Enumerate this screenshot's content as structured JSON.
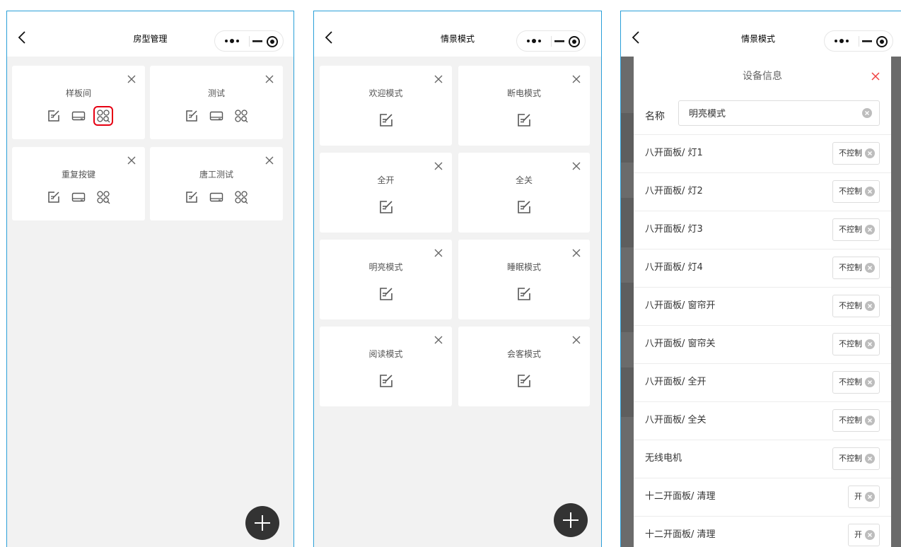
{
  "screen1": {
    "title": "房型管理",
    "cards": [
      {
        "name": "样板间"
      },
      {
        "name": "测试"
      },
      {
        "name": "重复按键"
      },
      {
        "name": "唐工测试"
      }
    ]
  },
  "screen2": {
    "title": "情景模式",
    "cards": [
      {
        "name": "欢迎模式"
      },
      {
        "name": "断电模式"
      },
      {
        "name": "全开"
      },
      {
        "name": "全关"
      },
      {
        "name": "明亮模式"
      },
      {
        "name": "睡眠模式"
      },
      {
        "name": "阅读模式"
      },
      {
        "name": "会客模式"
      }
    ]
  },
  "screen3": {
    "title": "情景模式",
    "modal_title": "设备信息",
    "name_label": "名称",
    "name_value": "明亮模式",
    "rows": [
      {
        "label": "八开面板/ 灯1",
        "value": "不控制"
      },
      {
        "label": "八开面板/ 灯2",
        "value": "不控制"
      },
      {
        "label": "八开面板/ 灯3",
        "value": "不控制"
      },
      {
        "label": "八开面板/ 灯4",
        "value": "不控制"
      },
      {
        "label": "八开面板/ 窗帘开",
        "value": "不控制"
      },
      {
        "label": "八开面板/ 窗帘关",
        "value": "不控制"
      },
      {
        "label": "八开面板/ 全开",
        "value": "不控制"
      },
      {
        "label": "八开面板/ 全关",
        "value": "不控制"
      },
      {
        "label": "无线电机",
        "value": "不控制"
      },
      {
        "label": "十二开面板/ 清理",
        "value": "开"
      },
      {
        "label": "十二开面板/ 清理",
        "value": "开"
      }
    ]
  },
  "colors": {
    "accent_frame": "#2a9fd8",
    "highlight": "#e60012",
    "close_red": "#f04040",
    "fab": "#333333",
    "page_bg": "#f2f2f2"
  },
  "icons": {
    "back": "chevron-left-icon",
    "more": "more-dots-icon",
    "minimize": "minimize-icon",
    "target": "target-icon",
    "close": "close-icon",
    "edit": "edit-icon",
    "device": "device-icon",
    "users": "users-search-icon",
    "add": "plus-icon",
    "clear": "clear-circle-icon"
  }
}
